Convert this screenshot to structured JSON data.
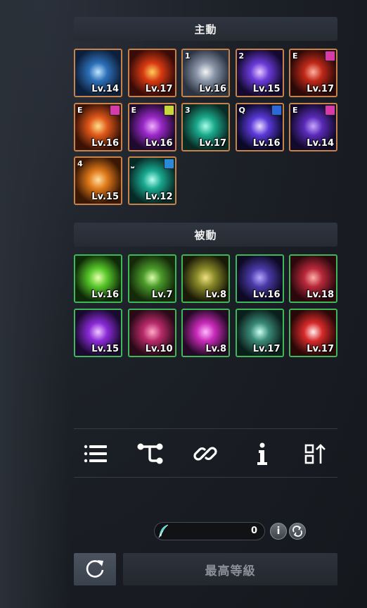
{
  "active": {
    "title": "主動",
    "skills": [
      {
        "key": "",
        "level": "Lv.14",
        "icon": "spirit-blade-icon",
        "badge": "",
        "colors": [
          "#bfe6ff",
          "#2c6fb8",
          "#0d1f3a"
        ]
      },
      {
        "key": "",
        "level": "Lv.17",
        "icon": "fire-vortex-icon",
        "badge": "",
        "colors": [
          "#ffcf5a",
          "#d83a12",
          "#3a0c08"
        ]
      },
      {
        "key": "1",
        "level": "Lv.16",
        "icon": "spear-thrust-icon",
        "badge": "",
        "colors": [
          "#f4f4f4",
          "#8a96a8",
          "#2c3442"
        ]
      },
      {
        "key": "2",
        "level": "Lv.15",
        "icon": "dark-orb-icon",
        "badge": "",
        "colors": [
          "#e8c8ff",
          "#6a3ad8",
          "#140a30"
        ]
      },
      {
        "key": "E",
        "level": "Lv.17",
        "icon": "stone-pillar-icon",
        "badge": "#d83aa8",
        "colors": [
          "#ffb0a0",
          "#c02818",
          "#2a0a08"
        ]
      },
      {
        "key": "E",
        "level": "Lv.16",
        "icon": "flame-claws-icon",
        "badge": "#d83aa8",
        "colors": [
          "#ffe08a",
          "#e0581a",
          "#3a1206"
        ]
      },
      {
        "key": "E",
        "level": "Lv.16",
        "icon": "purple-spikes-icon",
        "badge": "#c8d83a",
        "colors": [
          "#f0b0ff",
          "#9a28c8",
          "#1e0a2e"
        ]
      },
      {
        "key": "3",
        "level": "Lv.17",
        "icon": "spirit-hand-icon",
        "badge": "",
        "colors": [
          "#a8ffe8",
          "#1aa88a",
          "#0a2a24"
        ]
      },
      {
        "key": "Q",
        "level": "Lv.16",
        "icon": "light-pillar-icon",
        "badge": "#2a6ad8",
        "colors": [
          "#e8e0ff",
          "#5a38d8",
          "#0a0a28"
        ]
      },
      {
        "key": "E",
        "level": "Lv.14",
        "icon": "shadow-slash-icon",
        "badge": "#d83aa8",
        "colors": [
          "#c8a8ff",
          "#5a2ab8",
          "#120a2a"
        ]
      },
      {
        "key": "4",
        "level": "Lv.15",
        "icon": "sun-burst-icon",
        "badge": "",
        "colors": [
          "#ffe0a0",
          "#e07a1a",
          "#3a1804"
        ]
      },
      {
        "key": "⎵",
        "level": "Lv.12",
        "icon": "wind-spiral-icon",
        "badge": "#2a8ad8",
        "colors": [
          "#b8fff0",
          "#18a890",
          "#082a26"
        ]
      }
    ]
  },
  "passive": {
    "title": "被動",
    "skills": [
      {
        "level": "Lv.16",
        "icon": "green-wings-icon",
        "colors": [
          "#e8ffb0",
          "#58c82a",
          "#0e2a08"
        ]
      },
      {
        "level": "Lv.7",
        "icon": "archer-icon",
        "colors": [
          "#d8ffa8",
          "#4a9a2a",
          "#142a0a"
        ]
      },
      {
        "level": "Lv.8",
        "icon": "hooded-warrior-icon",
        "colors": [
          "#f0e080",
          "#8a8a2a",
          "#1a1a08"
        ]
      },
      {
        "level": "Lv.16",
        "icon": "dark-hood-icon",
        "colors": [
          "#b8a8ff",
          "#4a3aa8",
          "#0e0a24"
        ]
      },
      {
        "level": "Lv.18",
        "icon": "raised-fist-icon",
        "colors": [
          "#ffb0a8",
          "#b8283a",
          "#2a080c"
        ]
      },
      {
        "level": "Lv.15",
        "icon": "purple-lightning-icon",
        "colors": [
          "#f0c8ff",
          "#8a2ad8",
          "#1a0a2e"
        ]
      },
      {
        "level": "Lv.10",
        "icon": "berserker-icon",
        "colors": [
          "#ffa8c8",
          "#b82a6a",
          "#2a0a18"
        ]
      },
      {
        "level": "Lv.8",
        "icon": "arcane-blade-icon",
        "colors": [
          "#ffb8ff",
          "#c82ab8",
          "#240a24"
        ]
      },
      {
        "level": "Lv.17",
        "icon": "armored-knight-icon",
        "colors": [
          "#c8fff0",
          "#3a8a78",
          "#0a1e1a"
        ]
      },
      {
        "level": "Lv.17",
        "icon": "crimson-spiral-icon",
        "colors": [
          "#fff0f0",
          "#d82a2a",
          "#2a0808"
        ]
      }
    ]
  },
  "toolbar": {
    "items": [
      {
        "name": "list-icon"
      },
      {
        "name": "skill-tree-icon"
      },
      {
        "name": "link-icon"
      },
      {
        "name": "info-icon"
      },
      {
        "name": "sort-icon"
      }
    ]
  },
  "resource": {
    "value": "0",
    "icon": "feather-icon"
  },
  "buttons": {
    "info_glyph": "i",
    "max_level_label": "最高等級"
  }
}
